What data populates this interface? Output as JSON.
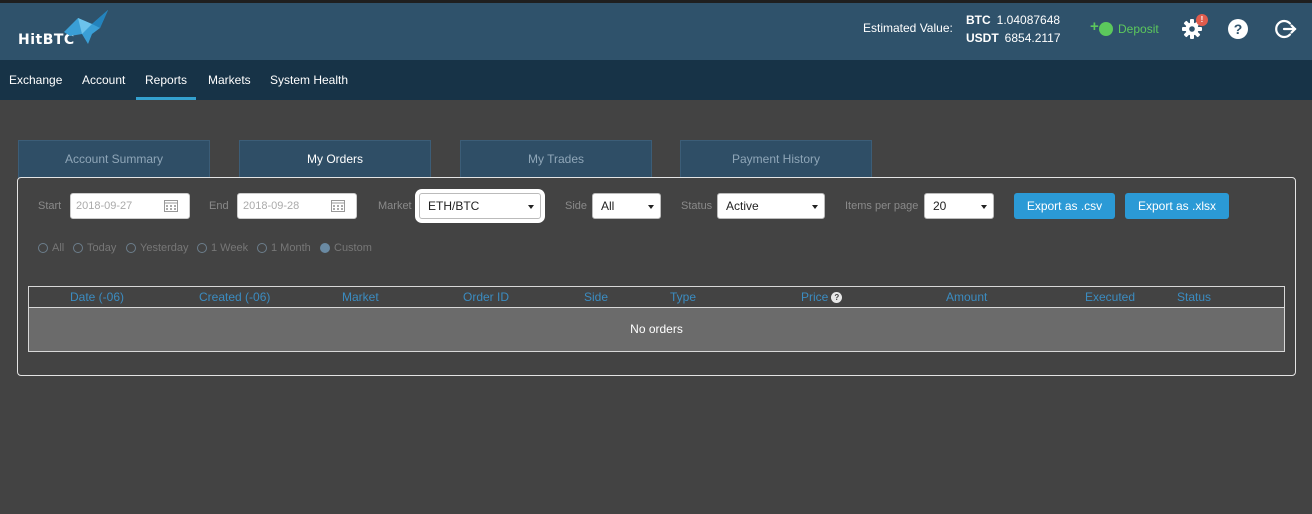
{
  "header": {
    "logo_text": "HitBTC",
    "estimated_label": "Estimated Value:",
    "balances": [
      {
        "currency": "BTC",
        "amount": "1.04087648"
      },
      {
        "currency": "USDT",
        "amount": "6854.2117"
      }
    ],
    "deposit_label": "Deposit",
    "notification_badge": "!",
    "colors": {
      "accent": "#34a1cf",
      "deposit": "#5cc85c",
      "badge": "#e05c4d"
    }
  },
  "nav": {
    "items": [
      {
        "label": "Exchange"
      },
      {
        "label": "Account"
      },
      {
        "label": "Reports"
      },
      {
        "label": "Markets"
      },
      {
        "label": "System Health"
      }
    ],
    "active": "Reports"
  },
  "tabs": {
    "items": [
      {
        "label": "Account Summary"
      },
      {
        "label": "My Orders"
      },
      {
        "label": "My Trades"
      },
      {
        "label": "Payment History"
      }
    ],
    "active": "My Orders"
  },
  "filters": {
    "start_label": "Start",
    "start_value": "2018-09-27",
    "end_label": "End",
    "end_value": "2018-09-28",
    "market_label": "Market",
    "market_value": "ETH/BTC",
    "side_label": "Side",
    "side_value": "All",
    "status_label": "Status",
    "status_value": "Active",
    "items_label": "Items per page",
    "items_value": "20",
    "export_csv": "Export as .csv",
    "export_xlsx": "Export as .xlsx"
  },
  "periods": {
    "items": [
      {
        "label": "All"
      },
      {
        "label": "Today"
      },
      {
        "label": "Yesterday"
      },
      {
        "label": "1 Week"
      },
      {
        "label": "1 Month"
      },
      {
        "label": "Custom"
      }
    ],
    "selected": "Custom"
  },
  "table": {
    "columns": [
      "Date (-06)",
      "Created (-06)",
      "Market",
      "Order ID",
      "Side",
      "Type",
      "Price",
      "Amount",
      "Executed",
      "Status"
    ],
    "price_help": "?",
    "empty_text": "No orders"
  }
}
